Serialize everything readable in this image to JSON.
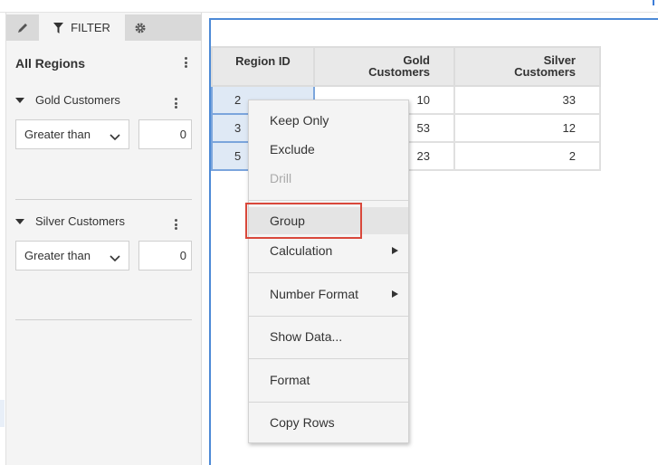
{
  "panel": {
    "tabs": {
      "edit_icon": "pencil-icon",
      "filter_label": "FILTER",
      "filter_icon": "funnel-icon",
      "settings_icon": "gear-icon"
    },
    "title": "All Regions",
    "filters": [
      {
        "label": "Gold Customers",
        "operator": "Greater than",
        "value": "0"
      },
      {
        "label": "Silver Customers",
        "operator": "Greater than",
        "value": "0"
      }
    ]
  },
  "table": {
    "headers": [
      "Region ID",
      "Gold\nCustomers",
      "Silver\nCustomers"
    ],
    "rows": [
      [
        "2",
        "10",
        "33"
      ],
      [
        "3",
        "53",
        "12"
      ],
      [
        "5",
        "23",
        "2"
      ]
    ]
  },
  "context_menu": {
    "items": [
      {
        "label": "Keep Only"
      },
      {
        "label": "Exclude"
      },
      {
        "label": "Drill",
        "disabled": true
      },
      {
        "label": "Group",
        "highlighted": true
      },
      {
        "label": "Calculation",
        "submenu": true
      },
      {
        "label": "Number Format",
        "submenu": true
      },
      {
        "label": "Show Data..."
      },
      {
        "label": "Format"
      },
      {
        "label": "Copy Rows"
      }
    ]
  },
  "colors": {
    "accent": "#4d8ad6",
    "highlight": "#d9483b",
    "selection": "#dfe9f5"
  }
}
